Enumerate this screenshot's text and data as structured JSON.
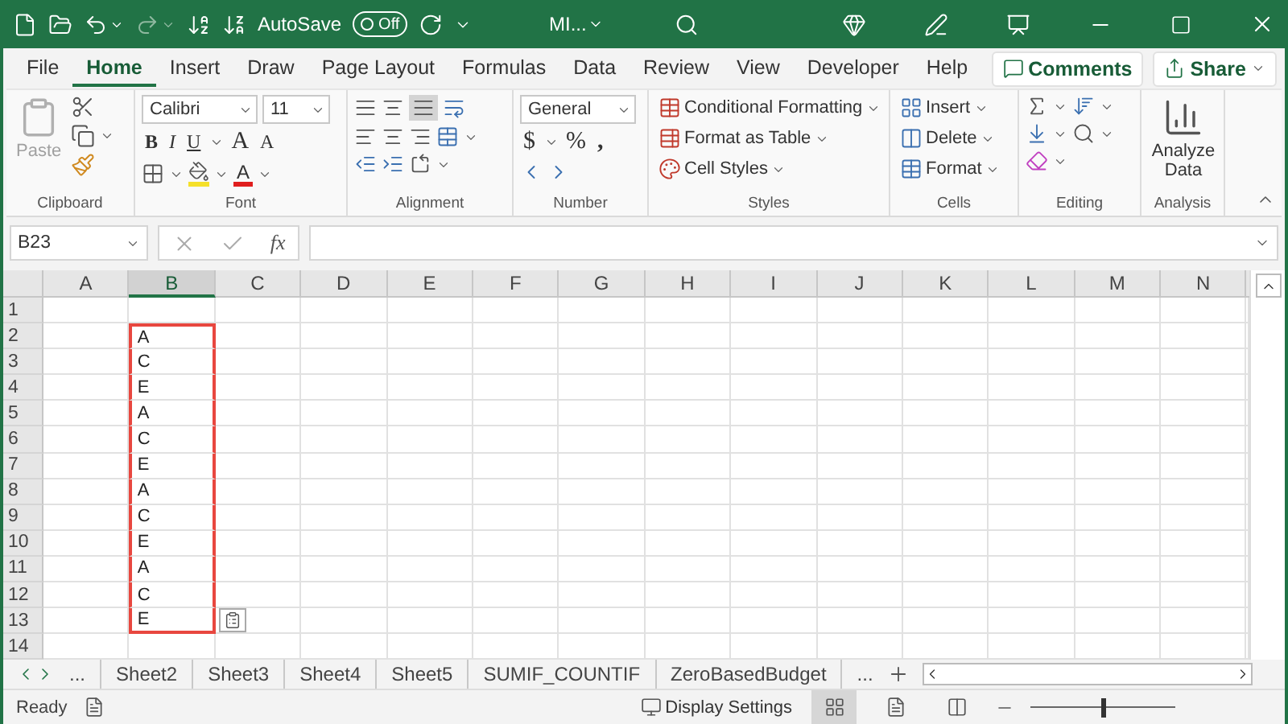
{
  "title_bar": {
    "autosave_label": "AutoSave",
    "autosave_on": false,
    "autosave_state": "Off",
    "document_title": "MI..."
  },
  "tabs": [
    {
      "label": "File",
      "selected": false
    },
    {
      "label": "Home",
      "selected": true
    },
    {
      "label": "Insert",
      "selected": false
    },
    {
      "label": "Draw",
      "selected": false
    },
    {
      "label": "Page Layout",
      "selected": false
    },
    {
      "label": "Formulas",
      "selected": false
    },
    {
      "label": "Data",
      "selected": false
    },
    {
      "label": "Review",
      "selected": false
    },
    {
      "label": "View",
      "selected": false
    },
    {
      "label": "Developer",
      "selected": false
    },
    {
      "label": "Help",
      "selected": false
    }
  ],
  "comments_button": "Comments",
  "share_button": "Share",
  "ribbon": {
    "clipboard": {
      "label": "Clipboard",
      "paste": "Paste",
      "paste_disabled": true
    },
    "font": {
      "label": "Font",
      "font_name": "Calibri",
      "font_size": "11",
      "bold": "B",
      "italic": "I",
      "underline": "U",
      "grow": "A",
      "shrink": "A",
      "font_color": "A"
    },
    "alignment": {
      "label": "Alignment"
    },
    "number": {
      "label": "Number",
      "format": "General",
      "currency": "$",
      "percent": "%",
      "comma": ","
    },
    "styles": {
      "label": "Styles",
      "commands": [
        "Conditional Formatting",
        "Format as Table",
        "Cell Styles"
      ]
    },
    "cells": {
      "label": "Cells",
      "commands": [
        "Insert",
        "Delete",
        "Format"
      ]
    },
    "editing": {
      "label": "Editing"
    },
    "analysis": {
      "label": "Analysis",
      "command": "Analyze Data"
    }
  },
  "formula_bar": {
    "name_box": "B23",
    "fx": "fx"
  },
  "columns": [
    {
      "label": "A",
      "selected": false
    },
    {
      "label": "B",
      "selected": true
    },
    {
      "label": "C",
      "selected": false
    },
    {
      "label": "D",
      "selected": false
    },
    {
      "label": "E",
      "selected": false
    },
    {
      "label": "F",
      "selected": false
    },
    {
      "label": "G",
      "selected": false
    },
    {
      "label": "H",
      "selected": false
    },
    {
      "label": "I",
      "selected": false
    },
    {
      "label": "J",
      "selected": false
    },
    {
      "label": "K",
      "selected": false
    },
    {
      "label": "L",
      "selected": false
    },
    {
      "label": "M",
      "selected": false
    },
    {
      "label": "N",
      "selected": false
    }
  ],
  "rows": [
    {
      "label": "1",
      "outlined": false
    },
    {
      "label": "2",
      "b_value": "A",
      "outlined": true
    },
    {
      "label": "3",
      "b_value": "C",
      "outlined": true
    },
    {
      "label": "4",
      "b_value": "E",
      "outlined": true
    },
    {
      "label": "5",
      "b_value": "A",
      "outlined": true
    },
    {
      "label": "6",
      "b_value": "C",
      "outlined": true
    },
    {
      "label": "7",
      "b_value": "E",
      "outlined": true
    },
    {
      "label": "8",
      "b_value": "A",
      "outlined": true
    },
    {
      "label": "9",
      "b_value": "C",
      "outlined": true
    },
    {
      "label": "10",
      "b_value": "E",
      "outlined": true
    },
    {
      "label": "11",
      "b_value": "A",
      "outlined": true
    },
    {
      "label": "12",
      "b_value": "C",
      "outlined": true
    },
    {
      "label": "13",
      "b_value": "E",
      "outlined": true,
      "paste_options": true
    },
    {
      "label": "14",
      "outlined": false
    }
  ],
  "sheet_tabs": {
    "more_before": "...",
    "tabs": [
      {
        "label": "Sheet2",
        "selected": false
      },
      {
        "label": "Sheet3",
        "selected": false
      },
      {
        "label": "Sheet4",
        "selected": false
      },
      {
        "label": "Sheet5",
        "selected": false
      },
      {
        "label": "SUMIF_COUNTIF",
        "selected": false
      },
      {
        "label": "ZeroBasedBudget",
        "selected": false
      }
    ],
    "more_after": "..."
  },
  "status_bar": {
    "status": "Ready",
    "display_settings": "Display Settings",
    "zoom": {
      "level": 0.5
    }
  }
}
